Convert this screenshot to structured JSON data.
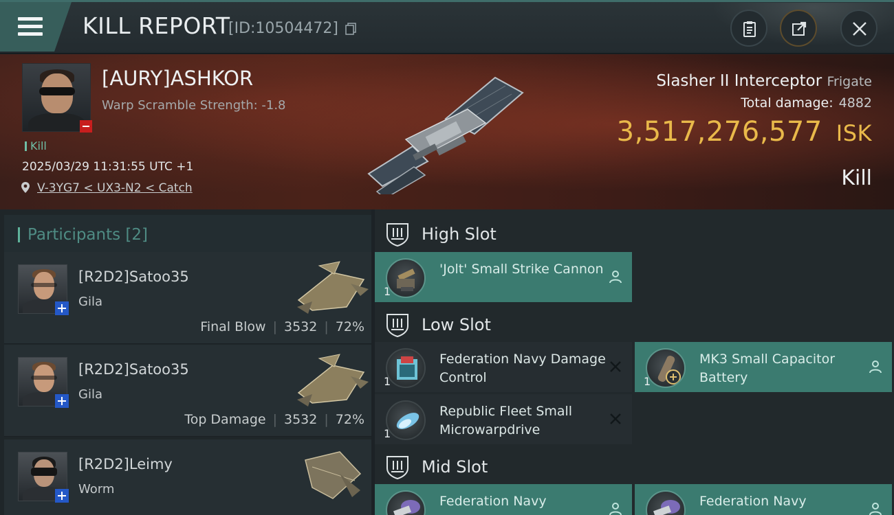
{
  "header": {
    "title": "KILL REPORT",
    "report_id": "[ID:10504472]"
  },
  "victim": {
    "name": "[AURY]ASHKOR",
    "warp": "Warp Scramble Strength: -1.8",
    "tag": "Kill",
    "datetime": "2025/03/29 11:31:55 UTC +1",
    "location": "V-3YG7 < UX3-N2 < Catch",
    "ship": "Slasher II Interceptor",
    "ship_class": "Frigate",
    "total_damage_label": "Total damage:",
    "total_damage": "4882",
    "isk_value": "3,517,276,577",
    "isk_unit": "ISK",
    "result": "Kill"
  },
  "participants": {
    "label": "Participants",
    "count": "[2]",
    "rows": [
      {
        "name": "[R2D2]Satoo35",
        "ship": "Gila",
        "role": "Final Blow",
        "damage": "3532",
        "percent": "72%"
      },
      {
        "name": "[R2D2]Satoo35",
        "ship": "Gila",
        "role": "Top Damage",
        "damage": "3532",
        "percent": "72%"
      },
      {
        "name": "[R2D2]Leimy",
        "ship": "Worm",
        "role": "",
        "damage": "",
        "percent": ""
      }
    ]
  },
  "slots": {
    "high": {
      "label": "High Slot",
      "items": [
        {
          "name": "'Jolt' Small Strike Cannon",
          "qty": "1",
          "state": "fitted",
          "icon": "cannon-icon"
        }
      ]
    },
    "low": {
      "label": "Low Slot",
      "items": [
        {
          "name": "Federation Navy Damage Control",
          "qty": "1",
          "state": "destroyed",
          "icon": "damage-control-icon"
        },
        {
          "name": "MK3 Small Capacitor Battery",
          "qty": "1",
          "state": "fitted",
          "icon": "capacitor-icon"
        },
        {
          "name": "Republic Fleet Small Microwarpdrive",
          "qty": "1",
          "state": "destroyed",
          "icon": "microwarpdrive-icon"
        }
      ]
    },
    "mid": {
      "label": "Mid Slot",
      "items": [
        {
          "name": "Federation Navy",
          "state": "fitted",
          "icon": "module-icon"
        },
        {
          "name": "Federation Navy",
          "state": "fitted",
          "icon": "module-icon"
        }
      ]
    }
  },
  "colors": {
    "accent_teal": "#3b7b70",
    "isk_gold": "#e9b94a",
    "hero_red": "#4a2219",
    "plus_blue": "#2458c7",
    "minus_red": "#c81e1e"
  }
}
